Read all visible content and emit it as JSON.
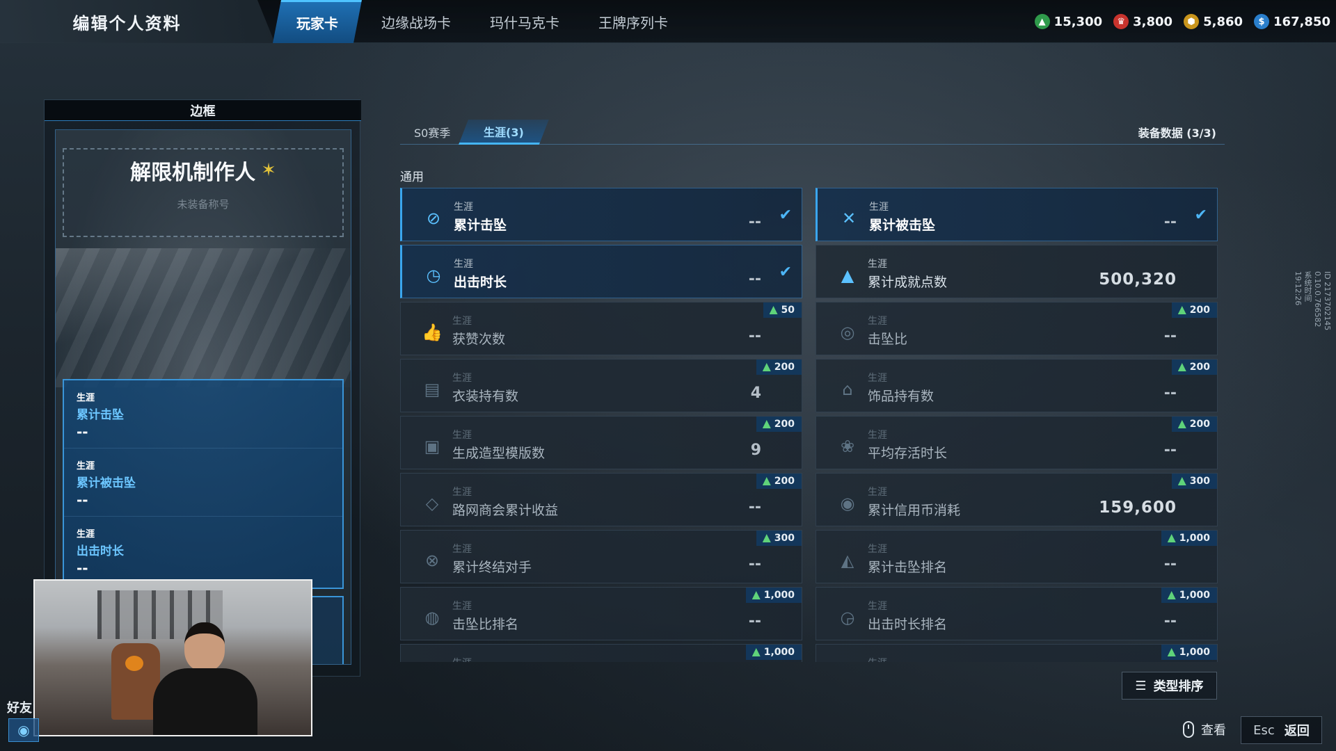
{
  "header": {
    "title": "编辑个人资料",
    "tabs": [
      {
        "label": "玩家卡",
        "active": true
      },
      {
        "label": "边缘战场卡",
        "active": false
      },
      {
        "label": "玛什马克卡",
        "active": false
      },
      {
        "label": "王牌序列卡",
        "active": false
      }
    ],
    "currencies": [
      {
        "icon": "green-triangle-icon",
        "color": "#5fd37a",
        "value": "15,300"
      },
      {
        "icon": "red-crest-icon",
        "color": "#e0413a",
        "value": "3,800"
      },
      {
        "icon": "gold-hex-icon",
        "color": "#e4b12a",
        "value": "5,860"
      },
      {
        "icon": "blue-coin-icon",
        "color": "#2f8fe0",
        "value": "167,850"
      }
    ]
  },
  "frame_panel": {
    "header": "边框",
    "title_name": "解限机制作人",
    "title_sub": "未装备称号",
    "stats": [
      {
        "category": "生涯",
        "name": "累计击坠",
        "value": "--"
      },
      {
        "category": "生涯",
        "name": "累计被击坠",
        "value": "--"
      },
      {
        "category": "生涯",
        "name": "出击时长",
        "value": "--"
      }
    ]
  },
  "sidebar": {
    "friends_label": "好友"
  },
  "subtabs": {
    "season": "S0赛季",
    "career": "生涯(3)",
    "equip_data": "装备数据 (3/3)"
  },
  "section_label": "通用",
  "stats_grid": [
    {
      "category": "生涯",
      "name": "累计击坠",
      "value": "--",
      "state": "equipped",
      "icon": "crosshair-icon",
      "glyph": "⊘"
    },
    {
      "category": "生涯",
      "name": "累计被击坠",
      "value": "--",
      "state": "equipped",
      "icon": "crossed-swords-icon",
      "glyph": "✕"
    },
    {
      "category": "生涯",
      "name": "出击时长",
      "value": "--",
      "state": "equipped",
      "icon": "clock-icon",
      "glyph": "◷"
    },
    {
      "category": "生涯",
      "name": "累计成就点数",
      "value": "500,320",
      "state": "owned",
      "icon": "achievement-icon",
      "glyph": "▲"
    },
    {
      "category": "生涯",
      "name": "获赞次数",
      "value": "--",
      "state": "locked",
      "cost": "50",
      "icon": "thumbs-up-icon",
      "glyph": "👍"
    },
    {
      "category": "生涯",
      "name": "击坠比",
      "value": "--",
      "state": "locked",
      "cost": "200",
      "icon": "ratio-icon",
      "glyph": "◎"
    },
    {
      "category": "生涯",
      "name": "衣装持有数",
      "value": "4",
      "state": "locked",
      "cost": "200",
      "icon": "outfit-icon",
      "glyph": "▤"
    },
    {
      "category": "生涯",
      "name": "饰品持有数",
      "value": "--",
      "state": "locked",
      "cost": "200",
      "icon": "accessory-icon",
      "glyph": "⌂"
    },
    {
      "category": "生涯",
      "name": "生成造型模版数",
      "value": "9",
      "state": "locked",
      "cost": "200",
      "icon": "template-icon",
      "glyph": "▣"
    },
    {
      "category": "生涯",
      "name": "平均存活时长",
      "value": "--",
      "state": "locked",
      "cost": "200",
      "icon": "survival-icon",
      "glyph": "❀"
    },
    {
      "category": "生涯",
      "name": "路网商会累计收益",
      "value": "--",
      "state": "locked",
      "cost": "200",
      "icon": "handshake-icon",
      "glyph": "◇"
    },
    {
      "category": "生涯",
      "name": "累计信用币消耗",
      "value": "159,600",
      "state": "locked",
      "cost": "300",
      "icon": "credit-coin-icon",
      "glyph": "◉"
    },
    {
      "category": "生涯",
      "name": "累计终结对手",
      "value": "--",
      "state": "locked",
      "cost": "300",
      "icon": "finisher-icon",
      "glyph": "⊗"
    },
    {
      "category": "生涯",
      "name": "累计击坠排名",
      "value": "--",
      "state": "locked",
      "cost": "1,000",
      "icon": "rank-icon",
      "glyph": "◭"
    },
    {
      "category": "生涯",
      "name": "击坠比排名",
      "value": "--",
      "state": "locked",
      "cost": "1,000",
      "icon": "ratio-rank-icon",
      "glyph": "◍"
    },
    {
      "category": "生涯",
      "name": "出击时长排名",
      "value": "--",
      "state": "locked",
      "cost": "1,000",
      "icon": "time-rank-icon",
      "glyph": "◶"
    },
    {
      "category": "生涯",
      "name": "",
      "value": "",
      "state": "locked",
      "cost": "1,000",
      "icon": "partial-icon",
      "glyph": ""
    },
    {
      "category": "生涯",
      "name": "",
      "value": "",
      "state": "locked",
      "cost": "1,000",
      "icon": "partial-icon",
      "glyph": ""
    }
  ],
  "footer": {
    "sort_label": "类型排序",
    "view_label": "查看",
    "esc_key": "Esc",
    "back_label": "返回"
  },
  "side_meta": [
    "ID 2173702145",
    "0.10.0.766582",
    "系统时间",
    "19:12:26"
  ]
}
